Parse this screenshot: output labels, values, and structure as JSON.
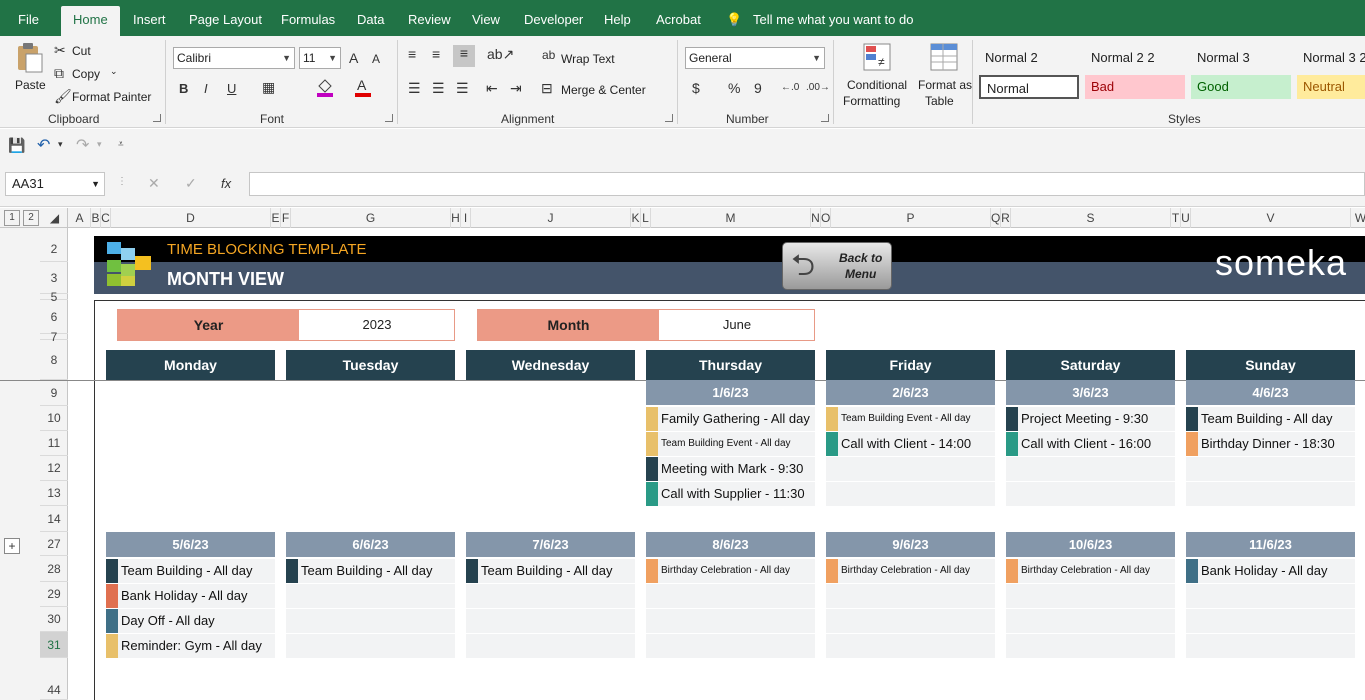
{
  "ribbon": {
    "tabs": [
      "File",
      "Home",
      "Insert",
      "Page Layout",
      "Formulas",
      "Data",
      "Review",
      "View",
      "Developer",
      "Help",
      "Acrobat"
    ],
    "tell_me": "Tell me what you want to do",
    "clipboard": {
      "paste": "Paste",
      "cut": "Cut",
      "copy": "Copy",
      "format_painter": "Format Painter",
      "label": "Clipboard"
    },
    "font": {
      "name": "Calibri",
      "size": "11",
      "label": "Font",
      "bold": "B",
      "italic": "I",
      "underline": "U",
      "grow": "A",
      "shrink": "A"
    },
    "alignment": {
      "wrap": "Wrap Text",
      "merge": "Merge & Center",
      "label": "Alignment"
    },
    "number": {
      "format": "General",
      "currency": "$",
      "percent": "%",
      "comma": "9",
      "label": "Number"
    },
    "conditional": {
      "line1": "Conditional",
      "line2": "Formatting"
    },
    "format_table": {
      "line1": "Format as",
      "line2": "Table"
    },
    "styles": {
      "label": "Styles",
      "cells": [
        {
          "name": "Normal 2",
          "bg": "#f3f3f3"
        },
        {
          "name": "Normal 2 2",
          "bg": "#f3f3f3"
        },
        {
          "name": "Normal 3",
          "bg": "#f3f3f3"
        },
        {
          "name": "Normal 3 2",
          "bg": "#f3f3f3"
        },
        {
          "name": "Normal",
          "bg": "#ffffff"
        },
        {
          "name": "Bad",
          "bg": "#ffc7ce",
          "fg": "#9c0006"
        },
        {
          "name": "Good",
          "bg": "#c6efce",
          "fg": "#006100"
        },
        {
          "name": "Neutral",
          "bg": "#ffeb9c",
          "fg": "#9c5700"
        }
      ]
    }
  },
  "formula_bar": {
    "name_box": "AA31",
    "fx": "fx",
    "formula": ""
  },
  "columns": [
    "A",
    "B",
    "C",
    "D",
    "E",
    "F",
    "G",
    "H",
    "I",
    "J",
    "K",
    "L",
    "M",
    "N",
    "O",
    "P",
    "Q",
    "R",
    "S",
    "T",
    "U",
    "V",
    "W"
  ],
  "rows": [
    "2",
    "3",
    "5",
    "6",
    "7",
    "8",
    "9",
    "10",
    "11",
    "12",
    "13",
    "14",
    "27",
    "28",
    "29",
    "30",
    "31",
    "44"
  ],
  "outline_levels": [
    "1",
    "2"
  ],
  "outline_expand": "+",
  "sheet": {
    "title": "TIME BLOCKING TEMPLATE",
    "subtitle": "MONTH VIEW",
    "back_button_line1": "Back to",
    "back_button_line2": "Menu",
    "brand": "someka",
    "year_label": "Year",
    "year_value": "2023",
    "month_label": "Month",
    "month_value": "June",
    "days": [
      "Monday",
      "Tuesday",
      "Wednesday",
      "Thursday",
      "Friday",
      "Saturday",
      "Sunday"
    ],
    "week1": {
      "dates": [
        "",
        "",
        "",
        "1/6/23",
        "2/6/23",
        "3/6/23",
        "4/6/23"
      ],
      "events": [
        [],
        [],
        [],
        [
          {
            "text": "Family Gathering - All day",
            "color": "#e8c06a"
          },
          {
            "text": "Team Building Event - All day",
            "color": "#e8c06a",
            "small": true
          },
          {
            "text": "Meeting with Mark - 9:30",
            "color": "#25424f"
          },
          {
            "text": "Call with Supplier - 11:30",
            "color": "#2a9a86"
          }
        ],
        [
          {
            "text": "Team Building Event - All day",
            "color": "#e8c06a",
            "small": true
          },
          {
            "text": "Call with Client - 14:00",
            "color": "#2a9a86"
          }
        ],
        [
          {
            "text": "Project Meeting - 9:30",
            "color": "#25424f"
          },
          {
            "text": "Call with Client - 16:00",
            "color": "#2a9a86"
          }
        ],
        [
          {
            "text": "Team Building - All day",
            "color": "#25424f"
          },
          {
            "text": "Birthday Dinner - 18:30",
            "color": "#f0a060"
          }
        ]
      ]
    },
    "week2": {
      "dates": [
        "5/6/23",
        "6/6/23",
        "7/6/23",
        "8/6/23",
        "9/6/23",
        "10/6/23",
        "11/6/23"
      ],
      "events": [
        [
          {
            "text": "Team Building - All day",
            "color": "#25424f"
          },
          {
            "text": "Bank Holiday - All day",
            "color": "#e07050"
          },
          {
            "text": "Day Off - All day",
            "color": "#3f6f86"
          },
          {
            "text": "Reminder: Gym - All day",
            "color": "#e8c06a"
          }
        ],
        [
          {
            "text": "Team Building - All day",
            "color": "#25424f"
          }
        ],
        [
          {
            "text": "Team Building - All day",
            "color": "#25424f"
          }
        ],
        [
          {
            "text": "Birthday Celebration - All day",
            "color": "#f0a060",
            "small": true
          }
        ],
        [
          {
            "text": "Birthday Celebration - All day",
            "color": "#f0a060",
            "small": true
          }
        ],
        [
          {
            "text": "Birthday Celebration - All day",
            "color": "#f0a060",
            "small": true
          }
        ],
        [
          {
            "text": "Bank Holiday - All day",
            "color": "#3f6f86"
          }
        ]
      ]
    }
  }
}
